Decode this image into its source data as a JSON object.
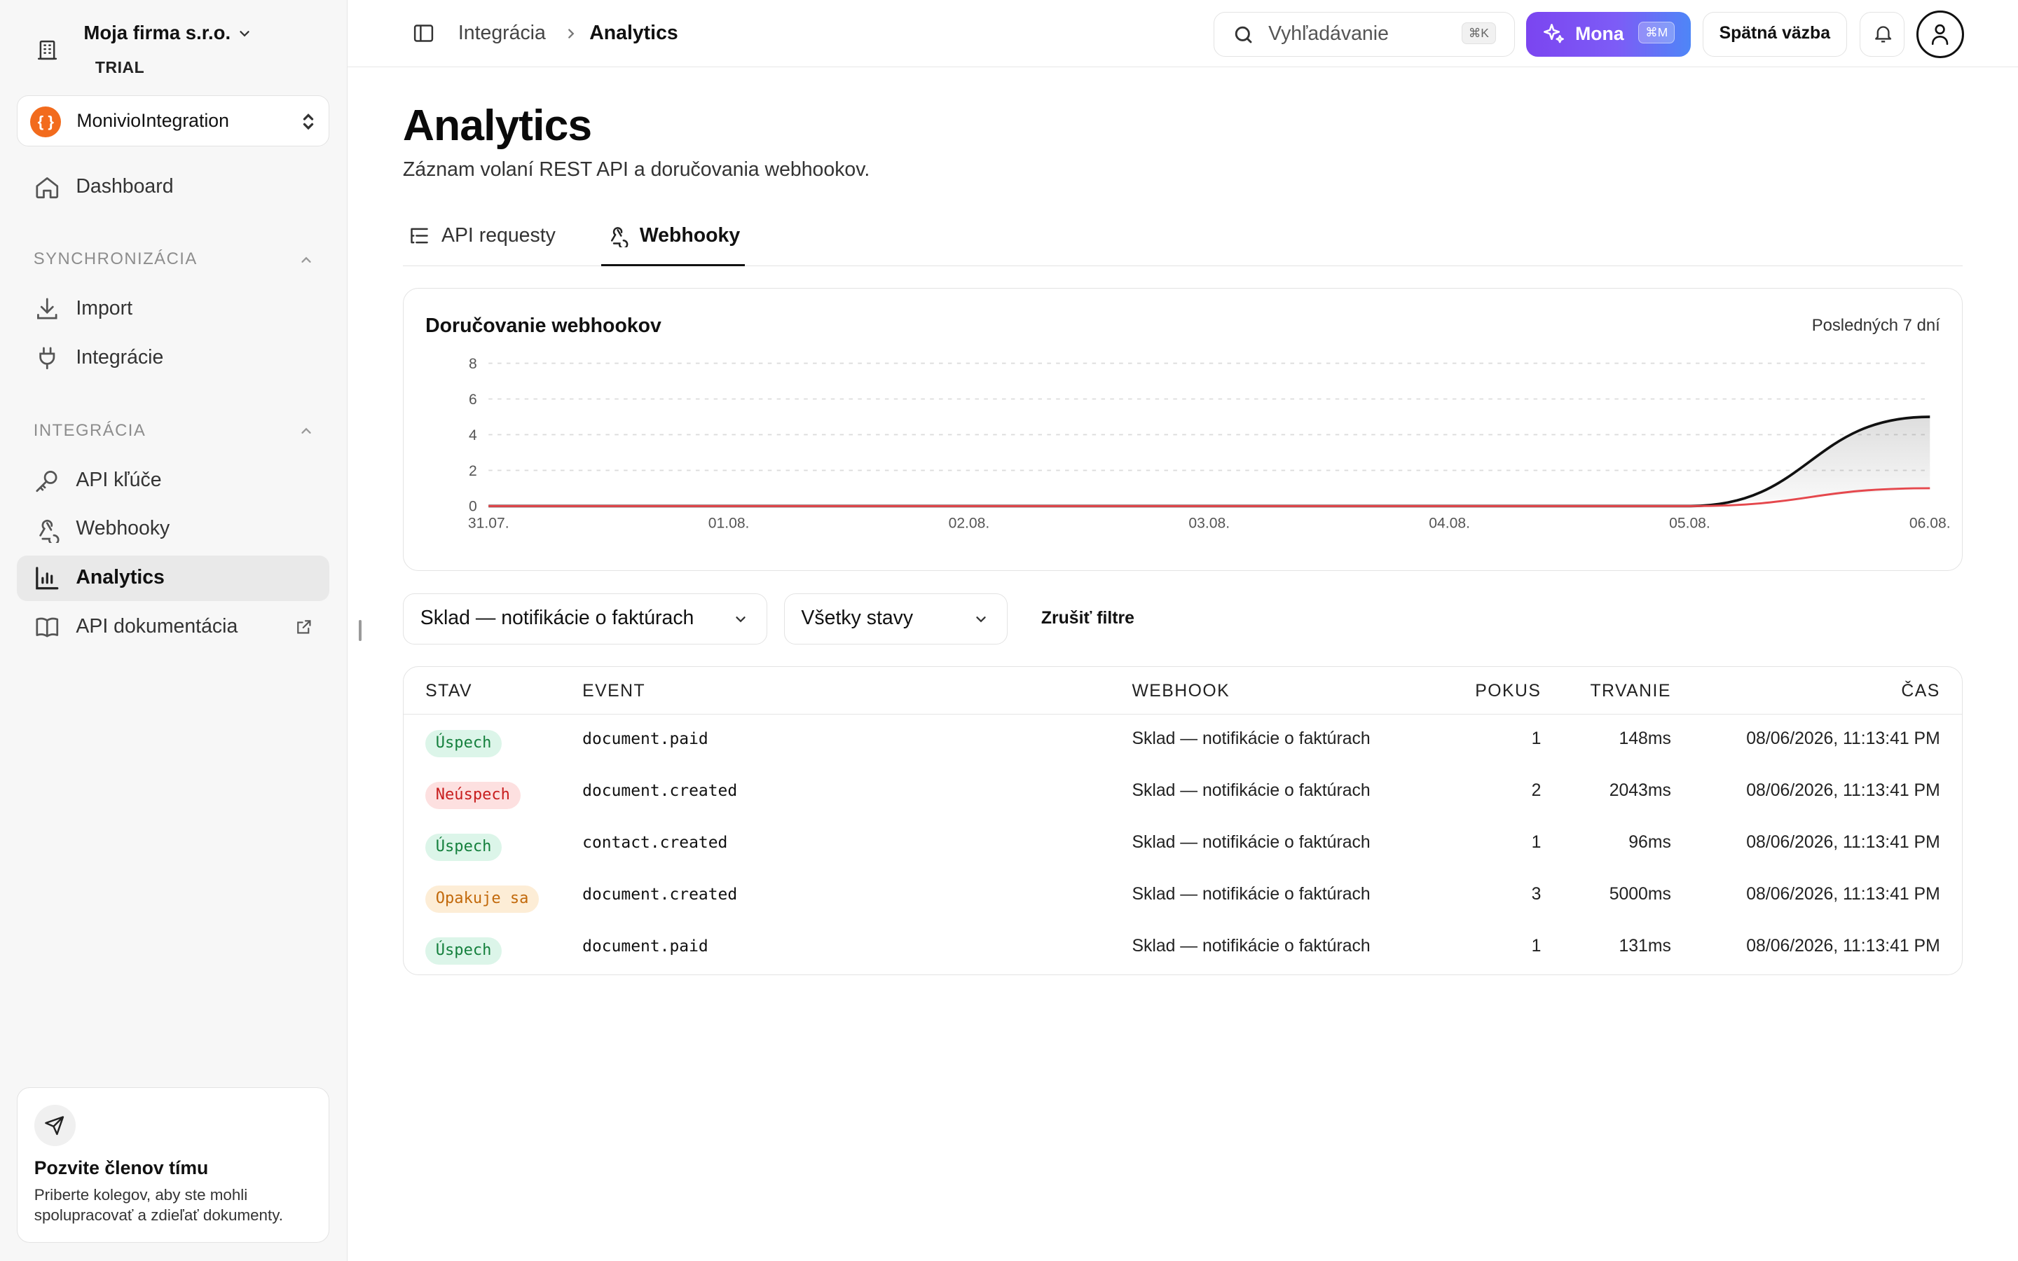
{
  "org": {
    "name": "Moja firma s.r.o.",
    "plan": "TRIAL"
  },
  "project": {
    "initial": "{ }",
    "name": "MonivioIntegration"
  },
  "nav": {
    "dashboard": "Dashboard",
    "sync_header": "SYNCHRONIZÁCIA",
    "import": "Import",
    "integracie": "Integrácie",
    "integ_header": "INTEGRÁCIA",
    "api_keys": "API kľúče",
    "webhooky": "Webhooky",
    "analytics": "Analytics",
    "api_docs": "API dokumentácia"
  },
  "invite": {
    "title": "Pozvite členov tímu",
    "desc": "Priberte kolegov, aby ste mohli spolupracovať a zdieľať dokumenty."
  },
  "topbar": {
    "breadcrumb_parent": "Integrácia",
    "breadcrumb_current": "Analytics",
    "search_placeholder": "Vyhľadávanie",
    "search_shortcut": "⌘K",
    "mona_label": "Mona",
    "mona_shortcut": "⌘M",
    "feedback_label": "Spätná väzba"
  },
  "page": {
    "title": "Analytics",
    "subtitle": "Záznam volaní REST API a doručovania webhookov."
  },
  "tabs": [
    {
      "label": "API requesty",
      "active": false
    },
    {
      "label": "Webhooky",
      "active": true
    }
  ],
  "chart_card": {
    "title": "Doručovanie webhookov",
    "range": "Posledných 7 dní"
  },
  "chart_data": {
    "type": "area",
    "title": "Doručovanie webhookov",
    "categories": [
      "31.07.",
      "01.08.",
      "02.08.",
      "03.08.",
      "04.08.",
      "05.08.",
      "06.08."
    ],
    "series": [
      {
        "values": [
          0,
          0,
          0,
          0,
          0,
          0,
          5
        ],
        "color": "#111111"
      },
      {
        "values": [
          0,
          0,
          0,
          0,
          0,
          0,
          1
        ],
        "color": "#e5484d"
      }
    ],
    "y_ticks": [
      0,
      2,
      4,
      6,
      8
    ],
    "ylim": [
      0,
      8
    ],
    "grid": true
  },
  "filters": {
    "webhook_select": "Sklad — notifikácie o faktúrach",
    "status_select": "Všetky stavy",
    "clear_label": "Zrušiť filtre"
  },
  "table": {
    "headers": {
      "stav": "STAV",
      "event": "EVENT",
      "webhook": "WEBHOOK",
      "pokus": "POKUS",
      "trvanie": "TRVANIE",
      "cas": "ČAS"
    },
    "rows": [
      {
        "status": "Úspech",
        "kind": "ok",
        "event": "document.paid",
        "webhook": "Sklad — notifikácie o faktúrach",
        "attempt": "1",
        "duration": "148ms",
        "time": "08/06/2026, 11:13:41 PM"
      },
      {
        "status": "Neúspech",
        "kind": "fail",
        "event": "document.created",
        "webhook": "Sklad — notifikácie o faktúrach",
        "attempt": "2",
        "duration": "2043ms",
        "time": "08/06/2026, 11:13:41 PM"
      },
      {
        "status": "Úspech",
        "kind": "ok",
        "event": "contact.created",
        "webhook": "Sklad — notifikácie o faktúrach",
        "attempt": "1",
        "duration": "96ms",
        "time": "08/06/2026, 11:13:41 PM"
      },
      {
        "status": "Opakuje sa",
        "kind": "retry",
        "event": "document.created",
        "webhook": "Sklad — notifikácie o faktúrach",
        "attempt": "3",
        "duration": "5000ms",
        "time": "08/06/2026, 11:13:41 PM"
      },
      {
        "status": "Úspech",
        "kind": "ok",
        "event": "document.paid",
        "webhook": "Sklad — notifikácie o faktúrach",
        "attempt": "1",
        "duration": "131ms",
        "time": "08/06/2026, 11:13:41 PM"
      }
    ]
  },
  "badge_colors": {
    "ok": {
      "bg": "#dcf5e9",
      "fg": "#15803d"
    },
    "fail": {
      "bg": "#fde0e0",
      "fg": "#c81e1e"
    },
    "retry": {
      "bg": "#fdedd6",
      "fg": "#c2690b"
    }
  }
}
